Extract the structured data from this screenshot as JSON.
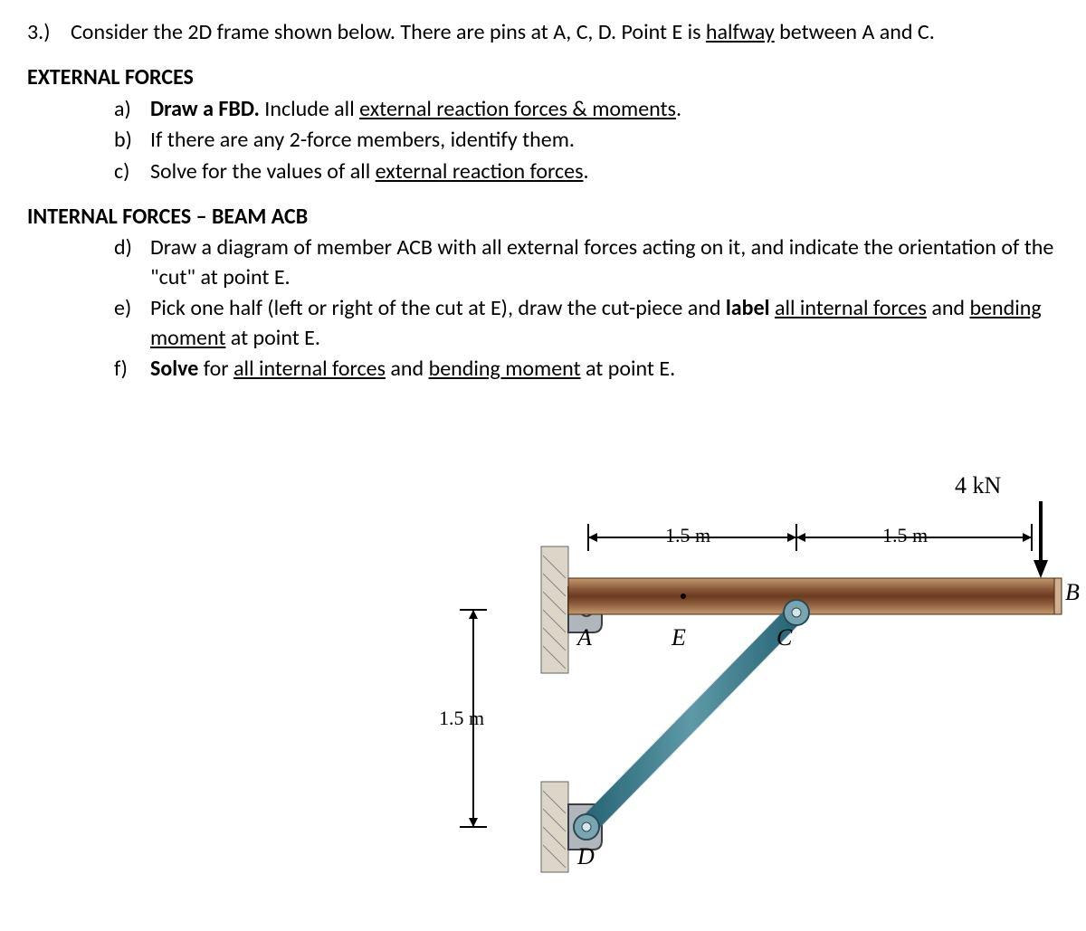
{
  "question": {
    "number": "3.)",
    "intro_part1": "Consider the 2D frame shown below. There are pins at A, C, D. Point E is ",
    "intro_underlined": "halfway",
    "intro_part2": " between A and C."
  },
  "section1": {
    "header": "EXTERNAL FORCES",
    "items": [
      {
        "letter": "a)",
        "parts": [
          {
            "text": "Draw a FBD.",
            "bold": true,
            "underline": false
          },
          {
            "text": " Include all ",
            "bold": false,
            "underline": false
          },
          {
            "text": "external reaction forces & moments",
            "bold": false,
            "underline": true
          },
          {
            "text": ".",
            "bold": false,
            "underline": false
          }
        ]
      },
      {
        "letter": "b)",
        "parts": [
          {
            "text": "If there are any 2-force members, identify them.",
            "bold": false,
            "underline": false
          }
        ]
      },
      {
        "letter": "c)",
        "parts": [
          {
            "text": "Solve for the values of all ",
            "bold": false,
            "underline": false
          },
          {
            "text": "external reaction forces",
            "bold": false,
            "underline": true
          },
          {
            "text": ".",
            "bold": false,
            "underline": false
          }
        ]
      }
    ]
  },
  "section2": {
    "header": "INTERNAL FORCES – BEAM ACB",
    "items": [
      {
        "letter": "d)",
        "parts": [
          {
            "text": "Draw a diagram of member ACB with all external forces acting on it, and indicate the orientation of the \"cut\" at point E.",
            "bold": false,
            "underline": false
          }
        ]
      },
      {
        "letter": "e)",
        "parts": [
          {
            "text": "Pick one half (left or right of the cut at E), draw the cut-piece and ",
            "bold": false,
            "underline": false
          },
          {
            "text": "label",
            "bold": true,
            "underline": false
          },
          {
            "text": " ",
            "bold": false,
            "underline": false
          },
          {
            "text": "all internal forces",
            "bold": false,
            "underline": true
          },
          {
            "text": " and ",
            "bold": false,
            "underline": false
          },
          {
            "text": "bending moment",
            "bold": false,
            "underline": true
          },
          {
            "text": " at point E.",
            "bold": false,
            "underline": false
          }
        ]
      },
      {
        "letter": "f)",
        "parts": [
          {
            "text": "Solve",
            "bold": true,
            "underline": false
          },
          {
            "text": " for ",
            "bold": false,
            "underline": false
          },
          {
            "text": "all internal forces",
            "bold": false,
            "underline": true
          },
          {
            "text": " and ",
            "bold": false,
            "underline": false
          },
          {
            "text": "bending moment",
            "bold": false,
            "underline": true
          },
          {
            "text": " at point E.",
            "bold": false,
            "underline": false
          }
        ]
      }
    ]
  },
  "figure": {
    "force": "4 kN",
    "dim_AC": "1.5 m",
    "dim_CB": "1.5 m",
    "dim_AD": "1.5 m",
    "pt_A": "A",
    "pt_B": "B",
    "pt_C": "C",
    "pt_D": "D",
    "pt_E": "E"
  }
}
